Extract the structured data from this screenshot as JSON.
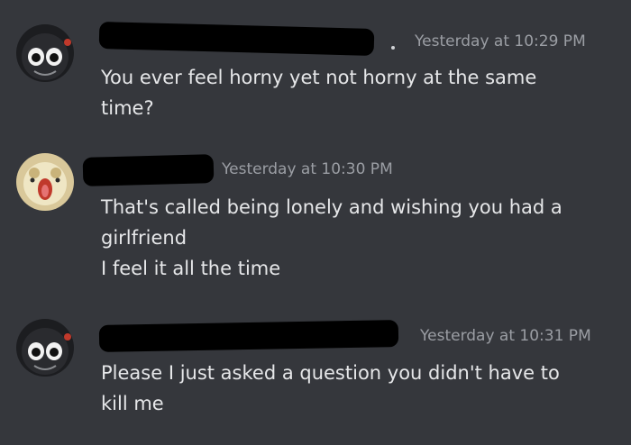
{
  "messages": [
    {
      "avatar_icon": "skull-avatar-icon",
      "timestamp": "Yesterday at 10:29 PM",
      "lines": [
        "You ever feel horny yet not horny at the same",
        "time?"
      ]
    },
    {
      "avatar_icon": "baby-bird-avatar-icon",
      "timestamp": "Yesterday at 10:30 PM",
      "lines": [
        "That's called being lonely and wishing you had a",
        "girlfriend",
        "I feel it all the time"
      ]
    },
    {
      "avatar_icon": "skull-avatar-icon",
      "timestamp": "Yesterday at 10:31 PM",
      "lines": [
        "Please I just asked a question you didn't have to",
        "kill me"
      ]
    }
  ],
  "colors": {
    "background": "#35373c",
    "text": "#e6e7e9",
    "timestamp": "#9b9ea4",
    "redaction": "#000000"
  }
}
